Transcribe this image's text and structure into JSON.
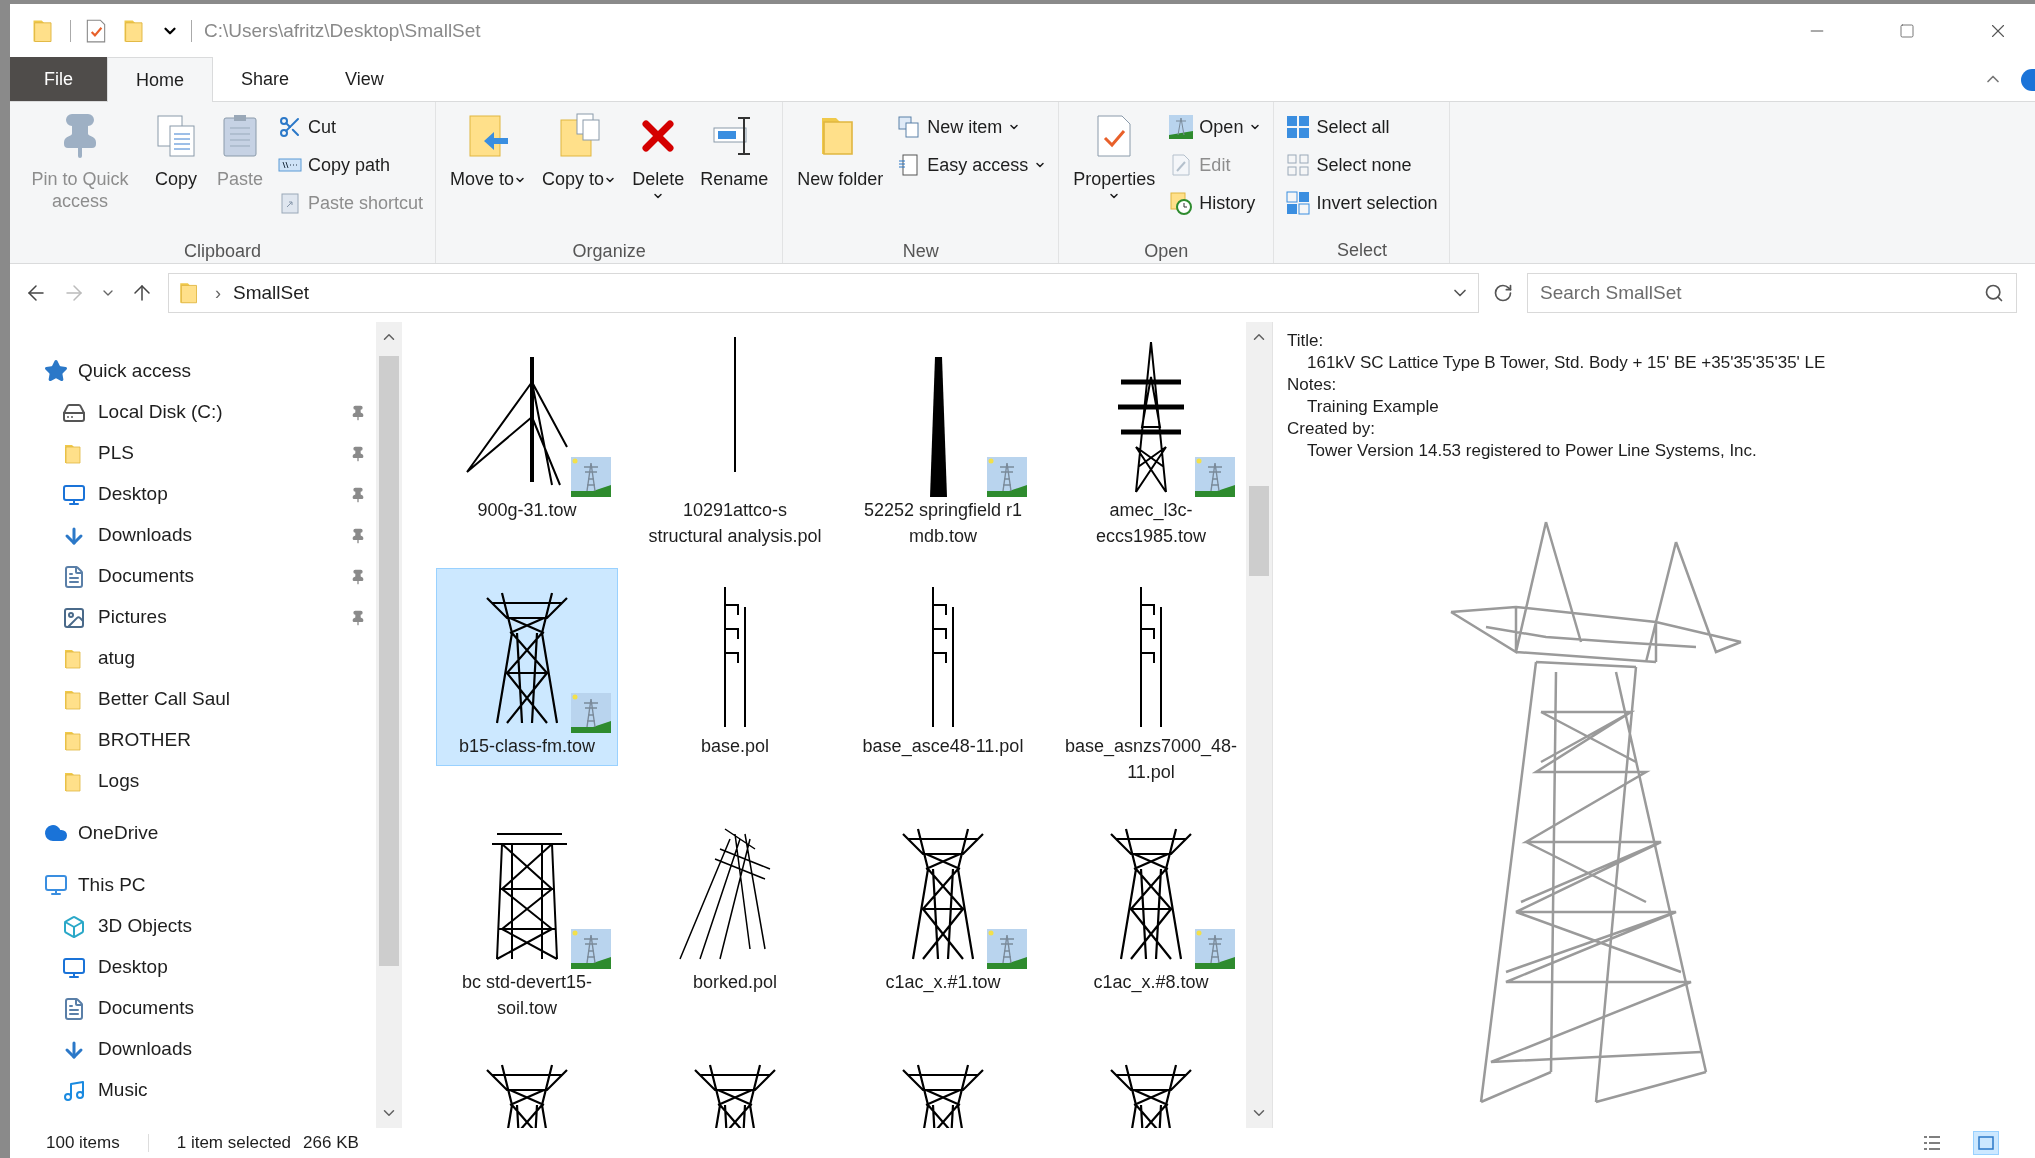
{
  "window": {
    "path": "C:\\Users\\afritz\\Desktop\\SmallSet"
  },
  "tabs": [
    {
      "label": "File",
      "kind": "file",
      "selected": false
    },
    {
      "label": "Home",
      "kind": "tab",
      "selected": true
    },
    {
      "label": "Share",
      "kind": "tab",
      "selected": false
    },
    {
      "label": "View",
      "kind": "tab",
      "selected": false
    }
  ],
  "ribbon": [
    {
      "label": "Clipboard",
      "columns": [
        [
          {
            "label": "Pin to Quick access",
            "kind": "large",
            "disabled": true
          }
        ],
        [
          {
            "label": "Copy",
            "kind": "large",
            "disabled": false
          }
        ],
        [
          {
            "label": "Paste",
            "kind": "large",
            "disabled": true
          }
        ],
        [
          {
            "label": "Cut",
            "kind": "small",
            "disabled": false
          },
          {
            "label": "Copy path",
            "kind": "small",
            "disabled": false
          },
          {
            "label": "Paste shortcut",
            "kind": "small",
            "disabled": true
          }
        ]
      ]
    },
    {
      "label": "Organize",
      "columns": [
        [
          {
            "label": "Move to",
            "kind": "large",
            "disabled": false,
            "dropdown": true
          }
        ],
        [
          {
            "label": "Copy to",
            "kind": "large",
            "disabled": false,
            "dropdown": true
          }
        ],
        [
          {
            "label": "Delete",
            "kind": "split",
            "disabled": false,
            "dropdown": true
          }
        ],
        [
          {
            "label": "Rename",
            "kind": "large",
            "disabled": false
          }
        ]
      ]
    },
    {
      "label": "New",
      "columns": [
        [
          {
            "label": "New folder",
            "kind": "large",
            "disabled": false
          }
        ],
        [
          {
            "label": "New item",
            "kind": "small",
            "disabled": false,
            "dropdown": true
          },
          {
            "label": "Easy access",
            "kind": "small",
            "disabled": false,
            "dropdown": true
          }
        ]
      ]
    },
    {
      "label": "Open",
      "columns": [
        [
          {
            "label": "Properties",
            "kind": "split",
            "disabled": false,
            "dropdown": true
          }
        ],
        [
          {
            "label": "Open",
            "kind": "small",
            "disabled": false,
            "dropdown": true
          },
          {
            "label": "Edit",
            "kind": "small",
            "disabled": true
          },
          {
            "label": "History",
            "kind": "small",
            "disabled": false
          }
        ]
      ]
    },
    {
      "label": "Select",
      "columns": [
        [
          {
            "label": "Select all",
            "kind": "small",
            "disabled": false
          },
          {
            "label": "Select none",
            "kind": "small",
            "disabled": false
          },
          {
            "label": "Invert selection",
            "kind": "small",
            "disabled": false
          }
        ]
      ]
    }
  ],
  "address": {
    "separator": "›",
    "crumb": "SmallSet",
    "search_placeholder": "Search SmallSet"
  },
  "sidebar": [
    {
      "label": "Quick access",
      "children": [
        {
          "label": "Local Disk (C:)",
          "pinned": true
        },
        {
          "label": "PLS",
          "pinned": true
        },
        {
          "label": "Desktop",
          "pinned": true
        },
        {
          "label": "Downloads",
          "pinned": true
        },
        {
          "label": "Documents",
          "pinned": true
        },
        {
          "label": "Pictures",
          "pinned": true
        },
        {
          "label": "atug",
          "pinned": false
        },
        {
          "label": "Better Call Saul",
          "pinned": false
        },
        {
          "label": "BROTHER",
          "pinned": false
        },
        {
          "label": "Logs",
          "pinned": false
        }
      ]
    },
    {
      "label": "OneDrive"
    },
    {
      "label": "This PC",
      "children": [
        {
          "label": "3D Objects"
        },
        {
          "label": "Desktop"
        },
        {
          "label": "Documents"
        },
        {
          "label": "Downloads"
        },
        {
          "label": "Music"
        }
      ]
    }
  ],
  "files": [
    {
      "name": "900g-31.tow",
      "kind": "guyed",
      "badge": true,
      "selected": false
    },
    {
      "name": "10291attco-s structural analysis.pol",
      "kind": "pole",
      "badge": false,
      "selected": false
    },
    {
      "name": "52252 springfield r1 mdb.tow",
      "kind": "monopole",
      "badge": true,
      "selected": false
    },
    {
      "name": "amec_l3c-eccs1985.tow",
      "kind": "lattice",
      "badge": true,
      "selected": false
    },
    {
      "name": "b15-class-fm.tow",
      "kind": "waist",
      "badge": true,
      "selected": true
    },
    {
      "name": "base.pol",
      "kind": "ladder",
      "badge": false,
      "selected": false
    },
    {
      "name": "base_asce48-11.pol",
      "kind": "ladder",
      "badge": false,
      "selected": false
    },
    {
      "name": "base_asnzs7000_48-11.pol",
      "kind": "ladder",
      "badge": false,
      "selected": false
    },
    {
      "name": "bc std-devert15-soil.tow",
      "kind": "square",
      "badge": true,
      "selected": false
    },
    {
      "name": "borked.pol",
      "kind": "aframe",
      "badge": false,
      "selected": false
    },
    {
      "name": "c1ac_x.#1.tow",
      "kind": "waist",
      "badge": true,
      "selected": false
    },
    {
      "name": "c1ac_x.#8.tow",
      "kind": "waist",
      "badge": true,
      "selected": false
    },
    {
      "kind": "waist",
      "badge": false,
      "selected": false
    },
    {
      "kind": "waist",
      "badge": false,
      "selected": false
    },
    {
      "kind": "waist",
      "badge": false,
      "selected": false
    },
    {
      "kind": "waist",
      "badge": false,
      "selected": false
    }
  ],
  "details": [
    {
      "label": "Title:",
      "value": "161kV SC Lattice Type B Tower, Std. Body + 15' BE +35'35'35'35' LE"
    },
    {
      "label": "Notes:",
      "value": "Training Example"
    },
    {
      "label": "Created by:",
      "value": "Tower Version 14.53 registered to Power Line Systems, Inc."
    }
  ],
  "status_bar": {
    "count": "100 items",
    "selection": "1 item selected",
    "size": "266 KB"
  },
  "views": [
    {
      "selected": false
    },
    {
      "selected": true
    }
  ]
}
